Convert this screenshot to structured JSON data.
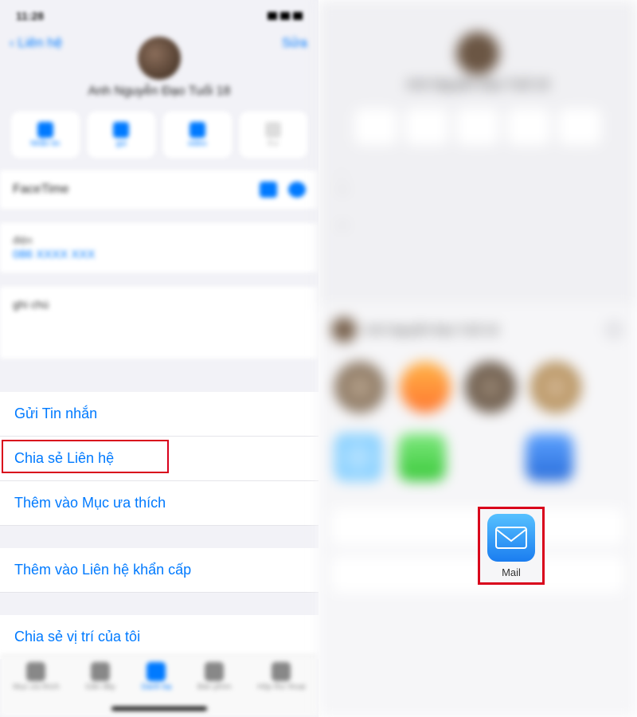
{
  "left": {
    "statusbar_time": "11:28",
    "back_label": "‹ Liên hệ",
    "edit_label": "Sửa",
    "contact_name": "Anh Nguyễn Đạo Tuổi 18",
    "actions": [
      "Nhắn tin",
      "gọi",
      "video",
      "thư"
    ],
    "facetime_label": "FaceTime",
    "phone_type": "điện",
    "phone_number": "086 XXXX XXX",
    "notes_label": "ghi chú",
    "list_items": {
      "send_message": "Gửi Tin nhắn",
      "share_contact": "Chia sẻ Liên hệ",
      "add_favorites": "Thêm vào Mục ưa thích",
      "add_emergency": "Thêm vào Liên hệ khẩn cấp",
      "share_location": "Chia sẻ vị trí của tôi"
    },
    "tabs": [
      "Mục ưa thích",
      "Gần đây",
      "Danh bạ",
      "Bàn phím",
      "Hộp thư thoại"
    ]
  },
  "right": {
    "contact_name": "Anh Nguyễn Đạo Tuổi 18",
    "mail_label": "Mail"
  }
}
